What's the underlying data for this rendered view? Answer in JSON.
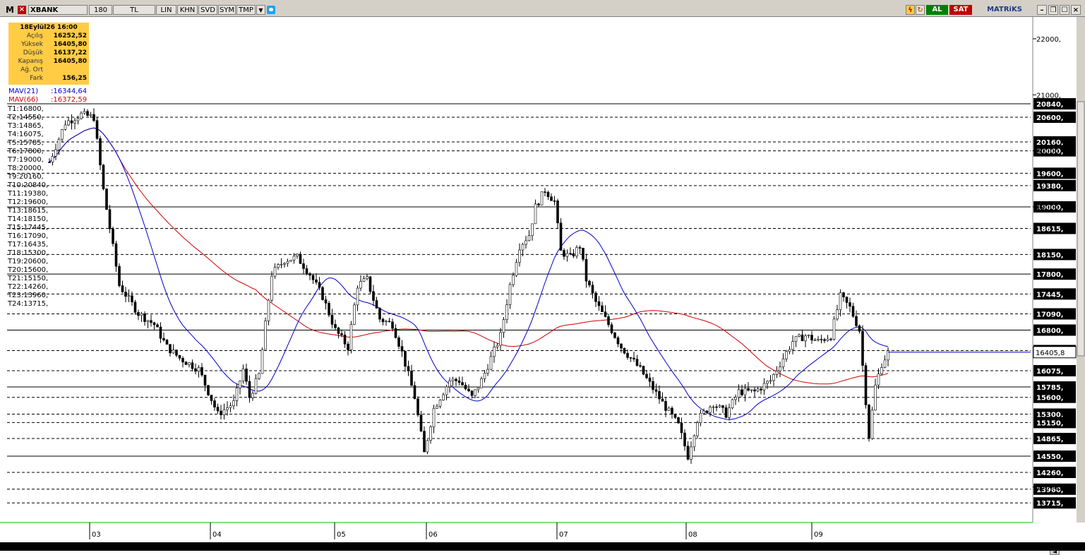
{
  "toolbar": {
    "logo": "M",
    "symbol": "XBANK",
    "cells": [
      "180",
      "TL",
      "LIN",
      "KHN",
      "SVD",
      "SYM",
      "TMP"
    ],
    "buy_label": "AL",
    "sell_label": "SAT",
    "brand": "MATRiKS",
    "colors": {
      "buy": "#008000",
      "sell": "#c00000",
      "panel": "#d4d0c8"
    }
  },
  "ohlc": {
    "date": "18Eylül26 16:00",
    "rows": [
      {
        "label": "Açılış",
        "value": "16252,52"
      },
      {
        "label": "Yüksek",
        "value": "16405,80"
      },
      {
        "label": "Düşük",
        "value": "16137,22"
      },
      {
        "label": "Kapanış",
        "value": "16405,80"
      },
      {
        "label": "Ağ. Ort",
        "value": ""
      },
      {
        "label": "Fark",
        "value": "156,25"
      }
    ]
  },
  "mav": [
    {
      "name": "MAV(21)",
      "value": ":16344,64",
      "color": "#0000cc"
    },
    {
      "name": "MAV(66)",
      "value": ":16372,59",
      "color": "#d00000"
    }
  ],
  "targets": [
    "T1:16800,",
    "T2:14550,",
    "T3:14865,",
    "T4:16075,",
    "T5:15785,",
    "T6:17800,",
    "T7:19000,",
    "T8:20000,",
    "T9:20160,",
    "T10:20840,",
    "T11:19380,",
    "T12:19600,",
    "T13:18615,",
    "T14:18150,",
    "T15:17445,",
    "T16:17090,",
    "T17:16435,",
    "T18:15300,",
    "T19:20600,",
    "T20:15600,",
    "T21:15150,",
    "T22:14260,",
    "T23:13960,",
    "T24:13715,"
  ],
  "chart_data": {
    "type": "candlestick",
    "ylim": [
      13150,
      22500
    ],
    "y_ticks": [
      "22000,",
      "21000,",
      "20000,",
      "19000,",
      "14000,"
    ],
    "current_price_label": "16405,8",
    "x_ticks": [
      "03",
      "04",
      "05",
      "06",
      "07",
      "08",
      "09"
    ],
    "horizontal_levels": [
      {
        "value": 20840,
        "label": "20840,",
        "style": "solid"
      },
      {
        "value": 20600,
        "label": "20600,",
        "style": "dashed"
      },
      {
        "value": 20160,
        "label": "20160,",
        "style": "dashed"
      },
      {
        "value": 20000,
        "label": "20000,",
        "style": "dashed"
      },
      {
        "value": 19600,
        "label": "19600,",
        "style": "dashed"
      },
      {
        "value": 19380,
        "label": "19380,",
        "style": "dashed"
      },
      {
        "value": 19000,
        "label": "19000,",
        "style": "solid"
      },
      {
        "value": 18615,
        "label": "18615,",
        "style": "dashed"
      },
      {
        "value": 18150,
        "label": "18150,",
        "style": "dashed"
      },
      {
        "value": 17800,
        "label": "17800,",
        "style": "solid"
      },
      {
        "value": 17445,
        "label": "17445,",
        "style": "dashed"
      },
      {
        "value": 17090,
        "label": "17090,",
        "style": "dashed"
      },
      {
        "value": 16800,
        "label": "16800,",
        "style": "solid"
      },
      {
        "value": 16435,
        "label": "16435,",
        "style": "dashed"
      },
      {
        "value": 16075,
        "label": "16075,",
        "style": "dashed"
      },
      {
        "value": 15785,
        "label": "15785,",
        "style": "solid"
      },
      {
        "value": 15600,
        "label": "15600,",
        "style": "dashed"
      },
      {
        "value": 15300,
        "label": "15300,",
        "style": "dashed"
      },
      {
        "value": 15150,
        "label": "15150,",
        "style": "dashed"
      },
      {
        "value": 14865,
        "label": "14865,",
        "style": "dashed"
      },
      {
        "value": 14550,
        "label": "14550,",
        "style": "solid"
      },
      {
        "value": 14260,
        "label": "14260,",
        "style": "dashed"
      },
      {
        "value": 13960,
        "label": "13960,",
        "style": "dashed"
      },
      {
        "value": 13715,
        "label": "13715,",
        "style": "dashed"
      }
    ],
    "price_path": [
      [
        0,
        19800
      ],
      [
        5,
        20500
      ],
      [
        10,
        20650
      ],
      [
        14,
        20600
      ],
      [
        17,
        19300
      ],
      [
        22,
        17600
      ],
      [
        28,
        17100
      ],
      [
        33,
        16900
      ],
      [
        37,
        16500
      ],
      [
        41,
        16300
      ],
      [
        47,
        16100
      ],
      [
        53,
        15300
      ],
      [
        58,
        15500
      ],
      [
        61,
        16100
      ],
      [
        63,
        15600
      ],
      [
        66,
        16000
      ],
      [
        70,
        17800
      ],
      [
        74,
        18050
      ],
      [
        78,
        18100
      ],
      [
        82,
        17800
      ],
      [
        86,
        17400
      ],
      [
        90,
        16800
      ],
      [
        94,
        16500
      ],
      [
        97,
        17600
      ],
      [
        100,
        17700
      ],
      [
        104,
        17000
      ],
      [
        108,
        16900
      ],
      [
        111,
        16400
      ],
      [
        115,
        15600
      ],
      [
        118,
        14600
      ],
      [
        121,
        15400
      ],
      [
        126,
        15900
      ],
      [
        129,
        15900
      ],
      [
        133,
        15600
      ],
      [
        136,
        15900
      ],
      [
        139,
        16300
      ],
      [
        142,
        16700
      ],
      [
        145,
        17600
      ],
      [
        148,
        18300
      ],
      [
        151,
        18500
      ],
      [
        153,
        19000
      ],
      [
        156,
        19300
      ],
      [
        159,
        19100
      ],
      [
        161,
        18200
      ],
      [
        164,
        18100
      ],
      [
        167,
        18300
      ],
      [
        169,
        17700
      ],
      [
        172,
        17300
      ],
      [
        175,
        17000
      ],
      [
        180,
        16500
      ],
      [
        186,
        16100
      ],
      [
        193,
        15500
      ],
      [
        198,
        15100
      ],
      [
        201,
        14550
      ],
      [
        204,
        15200
      ],
      [
        209,
        15500
      ],
      [
        213,
        15300
      ],
      [
        217,
        15700
      ],
      [
        222,
        15700
      ],
      [
        227,
        15900
      ],
      [
        231,
        16300
      ],
      [
        234,
        16600
      ],
      [
        238,
        16700
      ],
      [
        242,
        16600
      ],
      [
        246,
        16700
      ],
      [
        249,
        17400
      ],
      [
        252,
        17200
      ],
      [
        255,
        16800
      ],
      [
        258,
        14900
      ],
      [
        260,
        15800
      ],
      [
        262,
        16200
      ],
      [
        264,
        16400
      ]
    ],
    "series": [
      {
        "name": "MAV(21)",
        "color": "#0000cc"
      },
      {
        "name": "MAV(66)",
        "color": "#d00000"
      }
    ]
  }
}
